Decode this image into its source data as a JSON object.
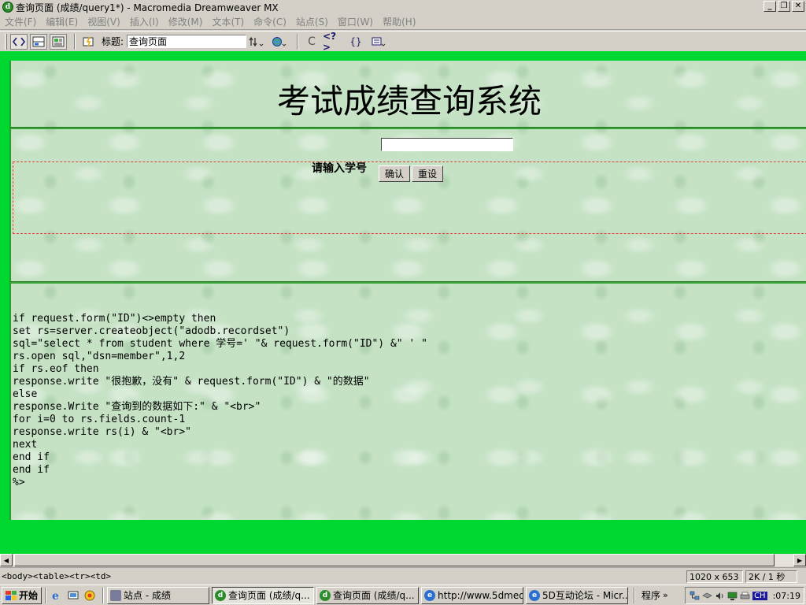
{
  "window": {
    "title": "查询页面 (成绩/query1*) - Macromedia Dreamweaver MX"
  },
  "menubar": {
    "items": [
      "文件(F)",
      "编辑(E)",
      "视图(V)",
      "插入(I)",
      "修改(M)",
      "文本(T)",
      "命令(C)",
      "站点(S)",
      "窗口(W)",
      "帮助(H)"
    ]
  },
  "toolbar": {
    "title_label": "标题:",
    "title_value": "查询页面",
    "refresh_glyph": "C",
    "code_glyph": "<?>",
    "braces_glyph": "{}"
  },
  "document": {
    "heading": "考试成绩查询系统",
    "prompt": "请输入学号",
    "confirm_button": "确认",
    "reset_button": "重设",
    "code_lines": [
      "if request.form(\"ID\")<>empty then",
      "set rs=server.createobject(\"adodb.recordset\")",
      "sql=\"select * from student where 学号=' \"& request.form(\"ID\") &\" ' \"",
      "rs.open sql,\"dsn=member\",1,2",
      "if rs.eof then",
      "response.write \"很抱歉，没有\" & request.form(\"ID\") & \"的数据\"",
      "else",
      "response.Write \"查询到的数据如下:\" & \"<br>\"",
      "for i=0 to rs.fields.count-1",
      "response.write rs(i) & \"<br>\"",
      "next",
      "end if",
      "end if",
      "%>"
    ]
  },
  "statusbar": {
    "tag_path": "<body><table><tr><td>",
    "window_size": "1020 x 653",
    "download_stats": "2K / 1 秒"
  },
  "taskbar": {
    "start_label": "开始",
    "tasks": [
      {
        "label": "站点 - 成绩",
        "icon": "site-icon",
        "active": false
      },
      {
        "label": "查询页面 (成绩/q...",
        "icon": "dreamweaver-icon",
        "active": true
      },
      {
        "label": "查询页面 (成绩/q...",
        "icon": "dreamweaver-icon",
        "active": false
      },
      {
        "label": "http://www.5dmed...",
        "icon": "ie-icon",
        "active": false
      },
      {
        "label": "5D互动论坛 - Micr...",
        "icon": "ie-icon",
        "active": false
      }
    ],
    "programs_label": "程序",
    "ime_label": "CH",
    "clock": ":07:19"
  }
}
